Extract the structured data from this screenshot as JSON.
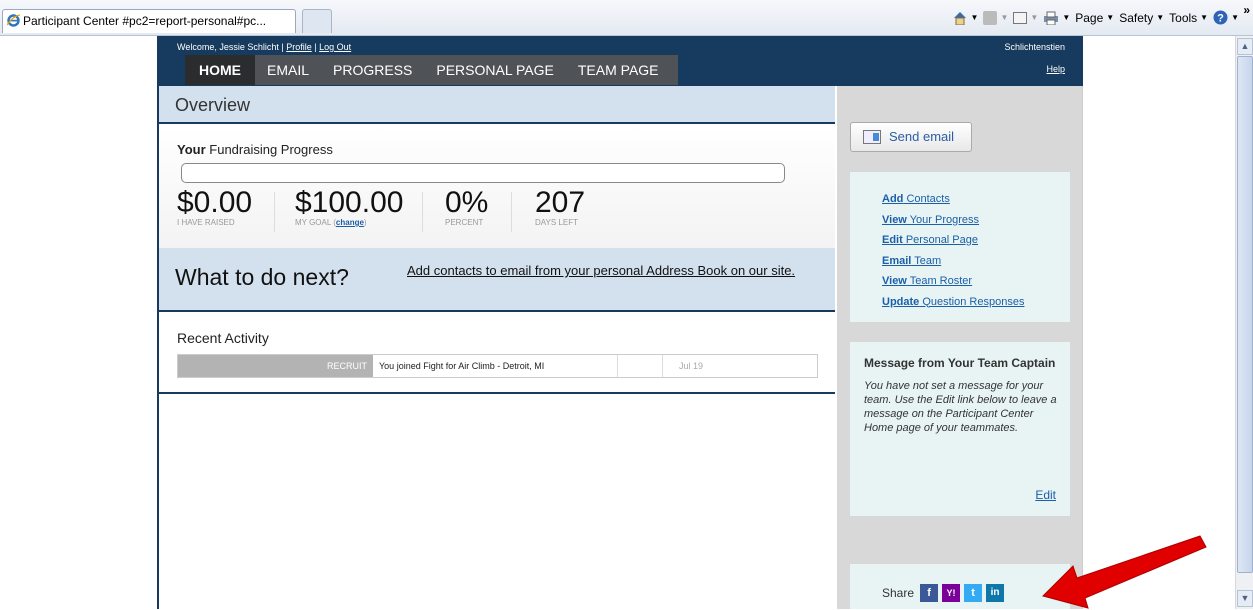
{
  "browser": {
    "tab_title": "Participant Center #pc2=report-personal#pc...",
    "page_label": "Page",
    "safety_label": "Safety",
    "tools_label": "Tools",
    "overflow": "»"
  },
  "header": {
    "welcome_prefix": "Welcome, Jessie Schlicht |",
    "profile_link": "Profile",
    "separator": "|",
    "logout_link": "Log Out",
    "username": "Schlichtenstien",
    "help_link": "Help"
  },
  "nav": {
    "items": [
      "HOME",
      "EMAIL",
      "PROGRESS",
      "PERSONAL PAGE",
      "TEAM PAGE"
    ],
    "active": "HOME"
  },
  "overview": {
    "title": "Overview"
  },
  "fundraising": {
    "title_bold": "Your",
    "title_rest": " Fundraising Progress",
    "progress_fraction": 0,
    "raised_value": "$0.00",
    "raised_label": "I HAVE RAISED",
    "goal_value": "$100.00",
    "goal_label": "MY GOAL (",
    "goal_change_link": "change",
    "goal_label_end": ")",
    "percent_value": "0%",
    "percent_label": "PERCENT",
    "days_value": "207",
    "days_label": "DAYS LEFT"
  },
  "next": {
    "heading": "What to do next?",
    "link": "Add contacts to email from your personal Address Book on our site."
  },
  "recent": {
    "title": "Recent Activity",
    "rows": [
      {
        "type": "RECRUIT",
        "desc": "You joined Fight for Air Climb - Detroit, MI",
        "date": "Jul 19"
      }
    ]
  },
  "sidebar": {
    "send_email": "Send email",
    "links": [
      {
        "bold": "Add",
        "rest": " Contacts"
      },
      {
        "bold": "View",
        "rest": " Your Progress"
      },
      {
        "bold": "Edit",
        "rest": " Personal Page"
      },
      {
        "bold": "Email",
        "rest": " Team"
      },
      {
        "bold": "View",
        "rest": " Team Roster"
      },
      {
        "bold": "Update",
        "rest": " Question Responses"
      }
    ],
    "message_title": "Message from Your Team Captain",
    "message_text": "You have not set a message for your team. Use the Edit link below to leave a message on the Participant Center Home page of your teammates.",
    "edit_link": "Edit",
    "share_label": "Share",
    "share_icons": [
      "f",
      "Y!",
      "t",
      "in"
    ]
  },
  "colors": {
    "header_bg": "#173b5e",
    "nav_bg": "#4f5357",
    "panel_bg": "#d3e1ee",
    "sidebar_bg": "#d8d8d8",
    "link": "#1a5fa8",
    "facebook": "#3b5998",
    "yahoo": "#7b0099",
    "twitter": "#33aaf3",
    "linkedin": "#0e76a8",
    "arrow": "#e00000"
  }
}
